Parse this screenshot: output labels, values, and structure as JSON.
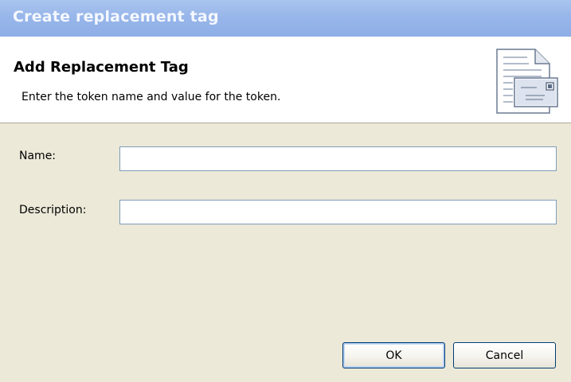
{
  "window": {
    "title": "Create replacement tag"
  },
  "header": {
    "heading": "Add Replacement Tag",
    "description": "Enter the token name and value for the token.",
    "icon": "wizard-envelope-document-icon"
  },
  "form": {
    "name_label": "Name:",
    "name_value": "",
    "description_label": "Description:",
    "description_value": ""
  },
  "buttons": {
    "ok_label": "OK",
    "cancel_label": "Cancel"
  },
  "colors": {
    "titlebar": "#98b6ea",
    "title_text": "#f4f8ff",
    "dialog_background": "#ece9d8",
    "header_background": "#ffffff",
    "input_border": "#7f9db9",
    "button_border": "#003c74"
  }
}
